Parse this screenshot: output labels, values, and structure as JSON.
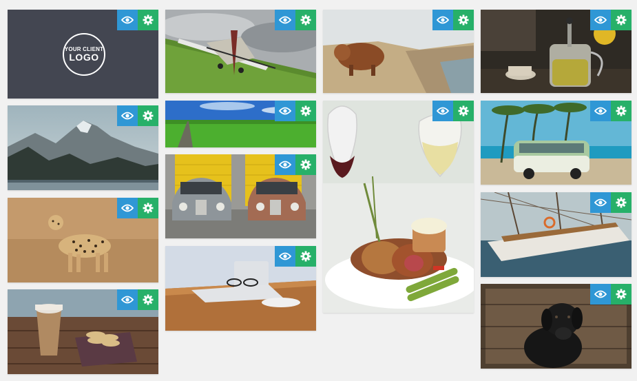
{
  "logo": {
    "line1": "YOUR CLIENT",
    "line2": "LOGO"
  },
  "colors": {
    "view_button": "#2f97d5",
    "settings_button": "#27b069",
    "logo_tile": "#434651",
    "page_bg": "#f1f1f1"
  },
  "icons": {
    "view": "eye-icon",
    "settings": "gear-icon"
  }
}
